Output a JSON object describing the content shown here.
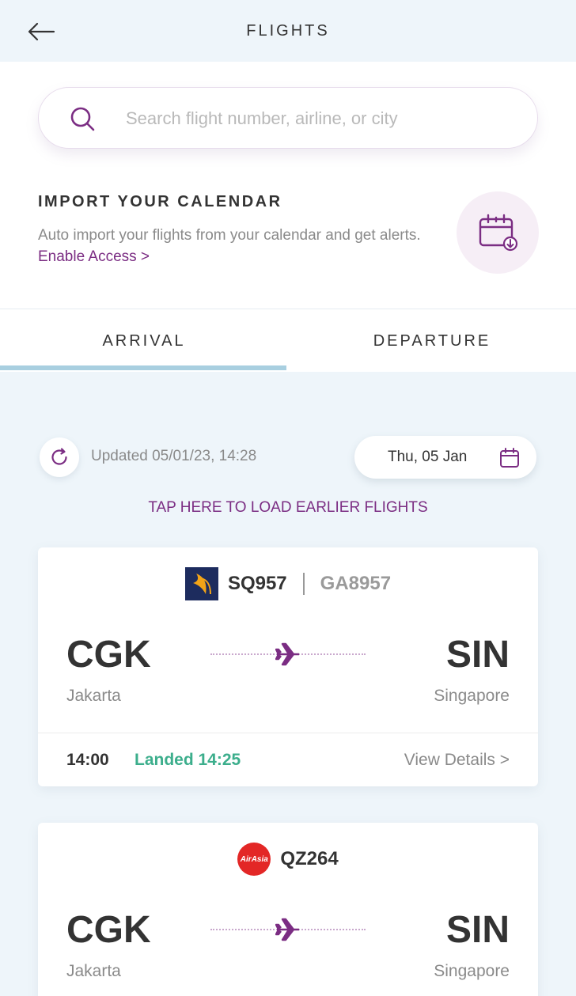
{
  "header": {
    "title": "FLIGHTS"
  },
  "search": {
    "placeholder": "Search flight number, airline, or city"
  },
  "import": {
    "title": "IMPORT YOUR CALENDAR",
    "description": "Auto import your flights from your calendar and get alerts.",
    "link": "Enable Access >"
  },
  "tabs": [
    {
      "label": "ARRIVAL",
      "active": true
    },
    {
      "label": "DEPARTURE",
      "active": false
    }
  ],
  "toolbar": {
    "updated": "Updated 05/01/23, 14:28",
    "date": "Thu, 05 Jan"
  },
  "load_earlier": "TAP HERE TO LOAD EARLIER FLIGHTS",
  "flights": [
    {
      "airline_logo": "singapore-airlines-logo",
      "flight_no": "SQ957",
      "codeshare": "GA8957",
      "origin_code": "CGK",
      "origin_city": "Jakarta",
      "dest_code": "SIN",
      "dest_city": "Singapore",
      "scheduled": "14:00",
      "status": "Landed 14:25",
      "details": "View Details >"
    },
    {
      "airline_logo": "airasia-logo",
      "airline_logo_text": "AirAsia",
      "flight_no": "QZ264",
      "origin_code": "CGK",
      "origin_city": "Jakarta",
      "dest_code": "SIN",
      "dest_city": "Singapore"
    }
  ],
  "colors": {
    "brand_purple": "#7b2d83",
    "status_green": "#3cae8c",
    "tab_indicator": "#a8cfe0",
    "background": "#eef5fa"
  }
}
